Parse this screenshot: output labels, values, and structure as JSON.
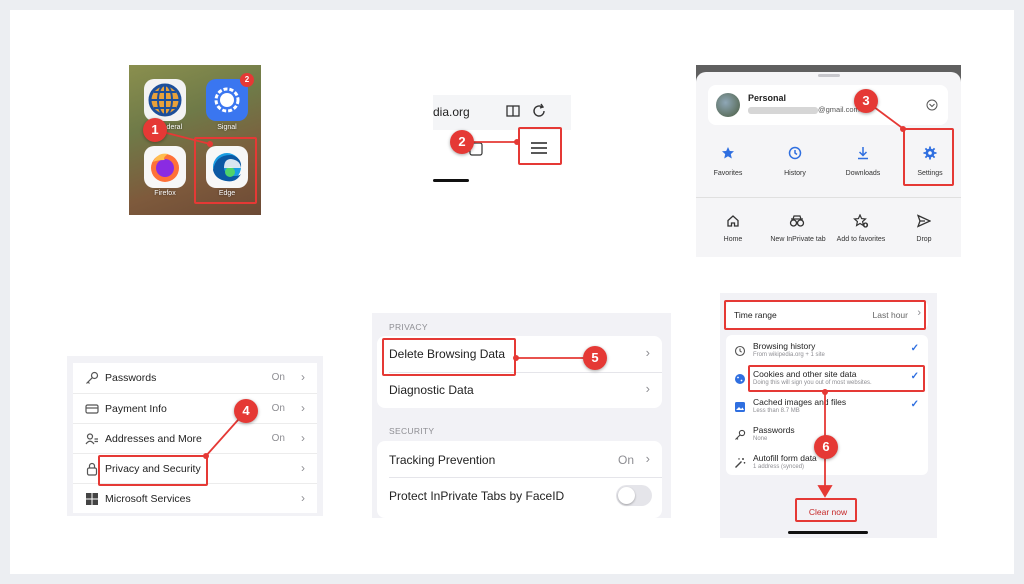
{
  "panel1": {
    "apps": [
      {
        "label": "…hunderal",
        "name": "globe-app"
      },
      {
        "label": "Signal",
        "badge": "2"
      },
      {
        "label": "Firefox"
      },
      {
        "label": "Edge"
      }
    ]
  },
  "panel2": {
    "url": "dia.org"
  },
  "panel3": {
    "profile_name": "Personal",
    "profile_email": "@gmail.com",
    "row1": [
      "Favorites",
      "History",
      "Downloads",
      "Settings"
    ],
    "row2": [
      "Home",
      "New InPrivate tab",
      "Add to favorites",
      "Drop"
    ]
  },
  "panel4": {
    "rows": [
      {
        "label": "Passwords",
        "value": "On",
        "icon": "key-icon"
      },
      {
        "label": "Payment Info",
        "value": "On",
        "icon": "card-icon"
      },
      {
        "label": "Addresses and More",
        "value": "On",
        "icon": "contacts-icon"
      },
      {
        "label": "Privacy and Security",
        "value": "",
        "icon": "lock-icon"
      },
      {
        "label": "Microsoft Services",
        "value": "",
        "icon": "microsoft-icon"
      }
    ]
  },
  "panel5": {
    "privacy_header": "PRIVACY",
    "delete_label": "Delete Browsing Data",
    "diagnostic_label": "Diagnostic Data",
    "security_header": "SECURITY",
    "tracking_label": "Tracking Prevention",
    "tracking_value": "On",
    "faceid_label": "Protect InPrivate Tabs by FaceID"
  },
  "panel6": {
    "time_range_label": "Time range",
    "time_range_value": "Last hour",
    "items": [
      {
        "title": "Browsing history",
        "sub": "From wikipedia.org + 1 site",
        "checked": true
      },
      {
        "title": "Cookies and other site data",
        "sub": "Doing this will sign you out of most websites.",
        "checked": true
      },
      {
        "title": "Cached images and files",
        "sub": "Less than 8.7 MB",
        "checked": true
      },
      {
        "title": "Passwords",
        "sub": "None",
        "checked": false
      },
      {
        "title": "Autofill form data",
        "sub": "1 address (synced)",
        "checked": false
      }
    ],
    "clear_button": "Clear now"
  },
  "steps": [
    "1",
    "2",
    "3",
    "4",
    "5",
    "6"
  ],
  "colors": {
    "accent_red": "#e53935",
    "edge_blue": "#2f6fe0",
    "signal_blue": "#3a76f0"
  }
}
